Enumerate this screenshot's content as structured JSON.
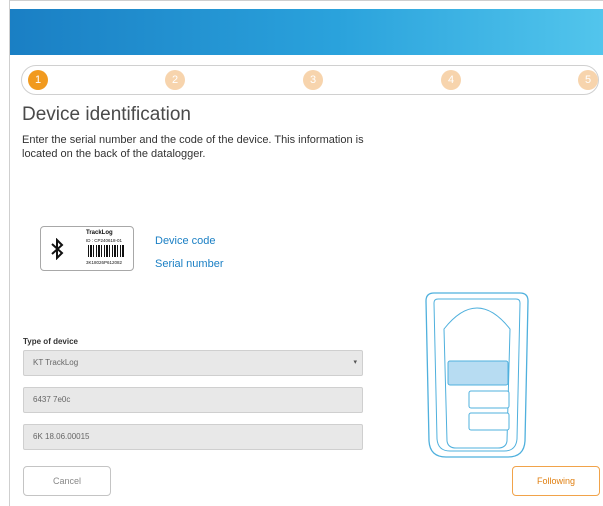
{
  "stepper": {
    "steps": [
      {
        "label": "1",
        "state": "active"
      },
      {
        "label": "2",
        "state": "inactive"
      },
      {
        "label": "3",
        "state": "inactive"
      },
      {
        "label": "4",
        "state": "inactive"
      },
      {
        "label": "5",
        "state": "inactive"
      }
    ],
    "colors": {
      "active": "#f19a1f",
      "inactive": "#f7d4ad"
    }
  },
  "page": {
    "title": "Device identification",
    "intro": "Enter the serial number and the code of the device. This information is located on the back of the datalogger."
  },
  "device_card": {
    "icon": "bluetooth-icon",
    "brand": "TrackLog",
    "id_text": "ID : CP240618-01",
    "serial_text": "3K18026P612082"
  },
  "links": {
    "device_code": "Device code",
    "serial_number": "Serial number"
  },
  "form": {
    "type_label": "Type of device",
    "type_value": "KT TrackLog",
    "type_caret": "▾",
    "device_code_value": "6437 7e0c",
    "serial_number_value": "6K 18.06.00015"
  },
  "buttons": {
    "cancel": "Cancel",
    "following": "Following"
  },
  "colors": {
    "banner_start": "#1a7fc4",
    "banner_end": "#52c5ec",
    "link": "#1a7fc4",
    "accent_orange": "#e07f10",
    "device_outline": "#4fb0dd",
    "screen_fill": "#b7dcf2"
  }
}
